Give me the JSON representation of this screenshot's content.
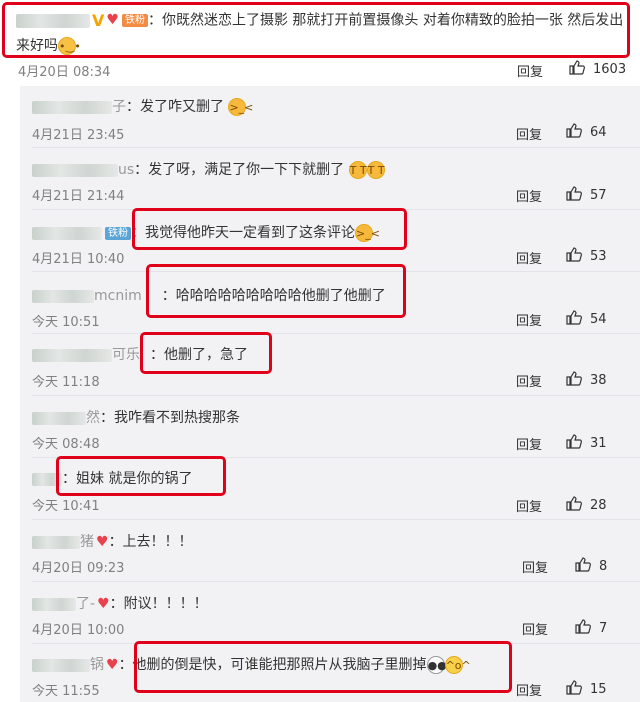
{
  "main": {
    "username_tail": "",
    "text": "：你既然迷恋上了摄影 那就打开前置摄像头 对着你精致的脸拍一张 然后发出来好吗",
    "time": "4月20日 08:34",
    "reply_label": "回复",
    "likes": "1603",
    "badge": "铁粉"
  },
  "replies": [
    {
      "name_tail": "子",
      "text": "：发了咋又删了",
      "time": "4月21日 23:45",
      "reply_label": "回复",
      "likes": "64"
    },
    {
      "name_tail": "us",
      "text": "：发了呀，满足了你一下下就删了",
      "time": "4月21日 21:44",
      "reply_label": "回复",
      "likes": "57"
    },
    {
      "name_tail": "",
      "badge": "铁粉",
      "text": "：我觉得他昨天一定看到了这条评论",
      "time": "4月21日 10:40",
      "reply_label": "回复",
      "likes": "53"
    },
    {
      "name_tail": "mcnim",
      "text": "：哈哈哈哈哈哈哈哈哈他删了他删了",
      "time": "今天 10:51",
      "reply_label": "回复",
      "likes": "54"
    },
    {
      "name_tail": "可乐",
      "text": "：他删了，急了",
      "time": "今天 11:18",
      "reply_label": "回复",
      "likes": "38"
    },
    {
      "name_tail": "然",
      "text": "：我咋看不到热搜那条",
      "time": "今天 08:48",
      "reply_label": "回复",
      "likes": "31"
    },
    {
      "name_tail": "",
      "text": "：姐妹 就是你的锅了",
      "time": "今天 10:41",
      "reply_label": "回复",
      "likes": "28"
    },
    {
      "name_tail": "猪",
      "text": "：上去！！！",
      "time": "4月20日 09:23",
      "reply_label": "回复",
      "likes": "8"
    },
    {
      "name_tail": "了-",
      "text": "：附议！！！！",
      "time": "4月20日 10:00",
      "reply_label": "回复",
      "likes": "7"
    },
    {
      "name_tail": "锅",
      "text": "：他删的倒是快，可谁能把那照片从我脑子里删掉",
      "time": "今天 11:55",
      "reply_label": "回复",
      "likes": "15"
    }
  ]
}
